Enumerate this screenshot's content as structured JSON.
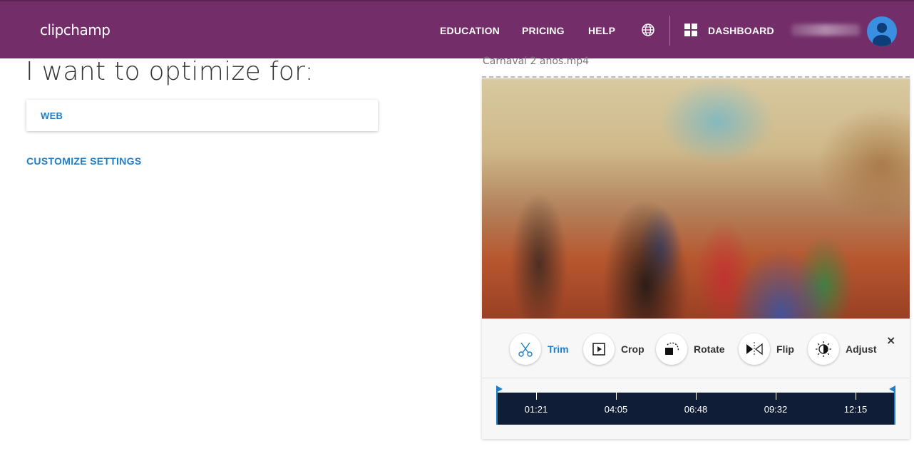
{
  "header": {
    "logo": "clipchamp",
    "nav": {
      "education": "EDUCATION",
      "pricing": "PRICING",
      "help": "HELP",
      "dashboard": "DASHBOARD"
    },
    "icons": [
      "globe-icon",
      "dashboard-grid-icon",
      "avatar-icon"
    ],
    "brand_color": "#732e69"
  },
  "left": {
    "title": "I want to optimize for:",
    "optimize_option": "WEB",
    "customize_link": "CUSTOMIZE SETTINGS",
    "link_color": "#1e7fc8"
  },
  "right": {
    "filename": "Carnaval 2 anos.mp4",
    "tools": {
      "trim": "Trim",
      "crop": "Crop",
      "rotate": "Rotate",
      "flip": "Flip",
      "adjust": "Adjust"
    },
    "active_tool": "Trim",
    "close": "×",
    "timeline": {
      "labels": [
        "01:21",
        "04:05",
        "06:48",
        "09:32",
        "12:15"
      ],
      "background": "#0f1d36"
    }
  }
}
